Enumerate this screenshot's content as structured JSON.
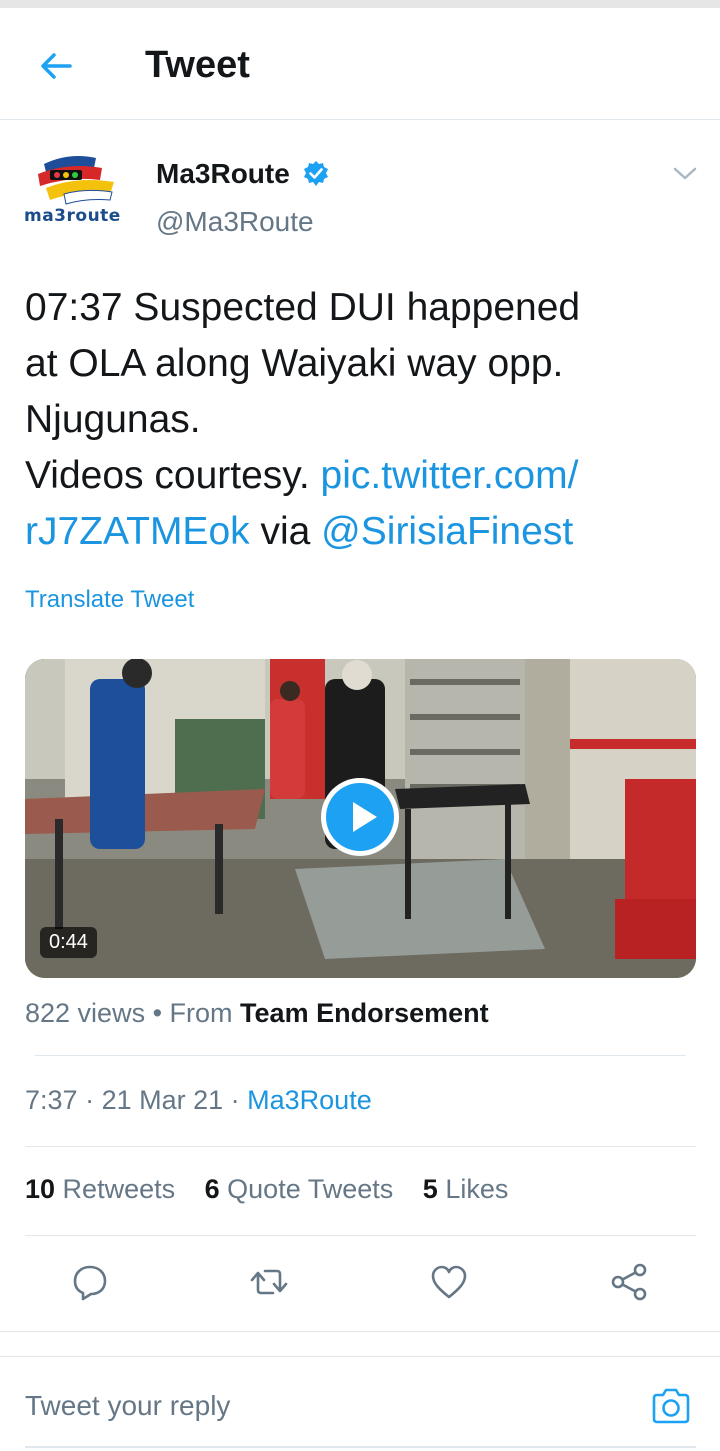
{
  "header": {
    "title": "Tweet"
  },
  "author": {
    "name": "Ma3Route",
    "handle": "@Ma3Route",
    "avatar_text": "ma3route"
  },
  "tweet": {
    "line1": "07:37 Suspected DUI happened",
    "line2": "at OLA along Waiyaki way opp.",
    "line3": "Njugunas.",
    "line4_text": "Videos courtesy.  ",
    "link_part1": "pic.twitter.com/",
    "link_part2": "rJ7ZATMEok",
    "via": " via ",
    "mention": "@SirisiaFinest",
    "translate": "Translate Tweet"
  },
  "media": {
    "duration": "0:44"
  },
  "views": {
    "count": "822 views",
    "dot": " • ",
    "from_label": "From ",
    "from_source": "Team Endorsement"
  },
  "meta": {
    "time": "7:37",
    "sep": " · ",
    "date": "21 Mar 21",
    "source": "Ma3Route"
  },
  "stats": {
    "retweets_count": "10",
    "retweets_label": " Retweets",
    "quotes_count": "6",
    "quotes_label": " Quote Tweets",
    "likes_count": "5",
    "likes_label": " Likes"
  },
  "reply": {
    "placeholder": "Tweet your reply"
  },
  "colors": {
    "accent": "#1da1f2",
    "link": "#1b95e0",
    "muted": "#657786"
  },
  "icons": [
    "back-arrow-icon",
    "verified-icon",
    "chevron-down-icon",
    "play-icon",
    "reply-icon",
    "retweet-icon",
    "like-icon",
    "share-icon",
    "camera-icon"
  ]
}
